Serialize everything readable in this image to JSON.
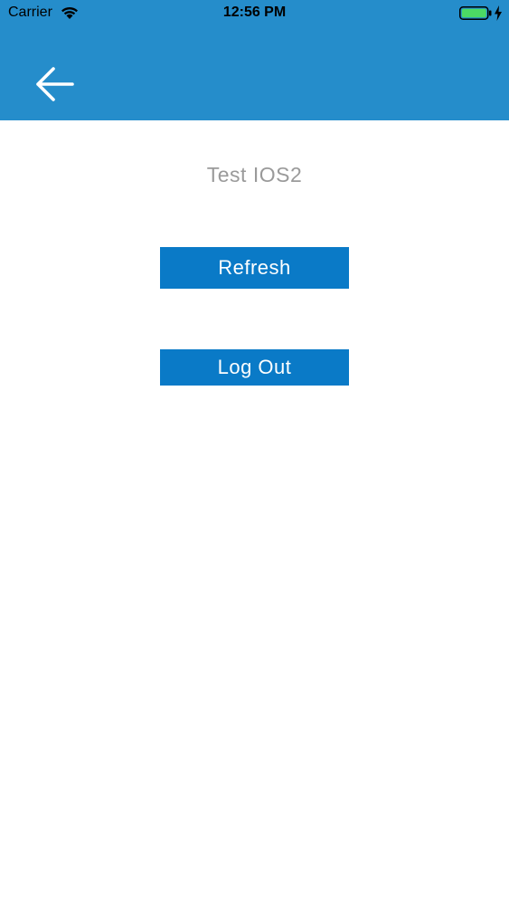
{
  "status_bar": {
    "carrier": "Carrier",
    "time": "12:56 PM",
    "battery_level": 1.0
  },
  "header": {
    "back_icon": "arrow-left-icon",
    "background_color": "#258dcb"
  },
  "main": {
    "title": "Test IOS2",
    "refresh_label": "Refresh",
    "logout_label": "Log Out",
    "button_color": "#0a7ac7"
  }
}
